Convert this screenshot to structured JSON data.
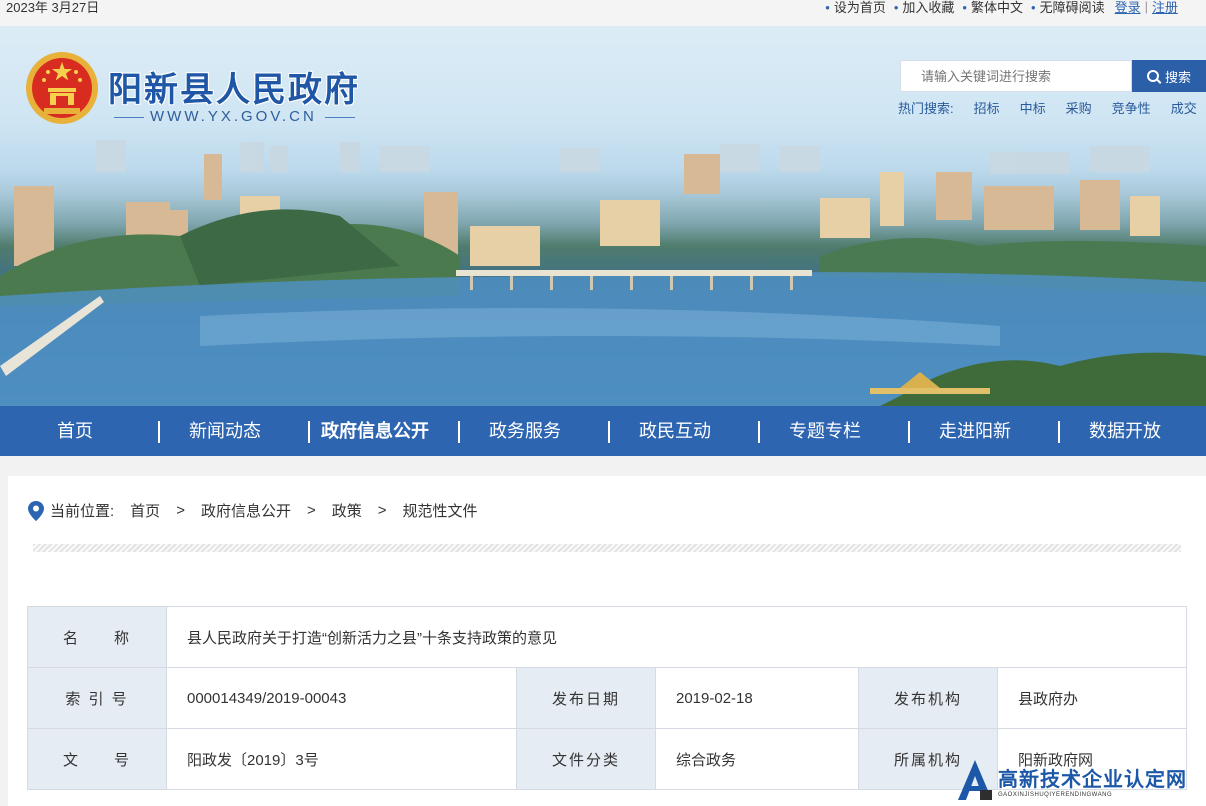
{
  "topbar": {
    "date": "2023年 3月27日",
    "links": [
      "设为首页",
      "加入收藏",
      "繁体中文",
      "无障碍阅读"
    ],
    "login": "登录",
    "register": "注册"
  },
  "header": {
    "site_title": "阳新县人民政府",
    "site_url": "WWW.YX.GOV.CN",
    "search_placeholder": "请输入关键词进行搜索",
    "search_button": "搜索",
    "hot_label": "热门搜索:",
    "hot_keywords": [
      "招标",
      "中标",
      "采购",
      "竞争性",
      "成交"
    ]
  },
  "nav": {
    "items": [
      "首页",
      "新闻动态",
      "政府信息公开",
      "政务服务",
      "政民互动",
      "专题专栏",
      "走进阳新",
      "数据开放"
    ],
    "active_index": 2
  },
  "breadcrumb": {
    "label": "当前位置:",
    "path": [
      "首页",
      "政府信息公开",
      "政策",
      "规范性文件"
    ],
    "separator": ">"
  },
  "info_table": {
    "name_label": "名　　称",
    "name_value": "县人民政府关于打造“创新活力之县”十条支持政策的意见",
    "index_label": "索 引 号",
    "index_value": "000014349/2019-00043",
    "date_label": "发布日期",
    "date_value": "2019-02-18",
    "org_label": "发布机构",
    "org_value": "县政府办",
    "docno_label": "文　　号",
    "docno_value": "阳政发〔2019〕3号",
    "category_label": "文件分类",
    "category_value": "综合政务",
    "belong_label": "所属机构",
    "belong_value": "阳新政府网"
  },
  "watermark": {
    "main": "高新技术企业认定网",
    "sub": "GAOXINJISHUQIYERENDINGWANG"
  },
  "colors": {
    "nav_bg": "#2e65b0",
    "title_blue": "#1f56a6",
    "label_bg": "#e6ecf3"
  }
}
